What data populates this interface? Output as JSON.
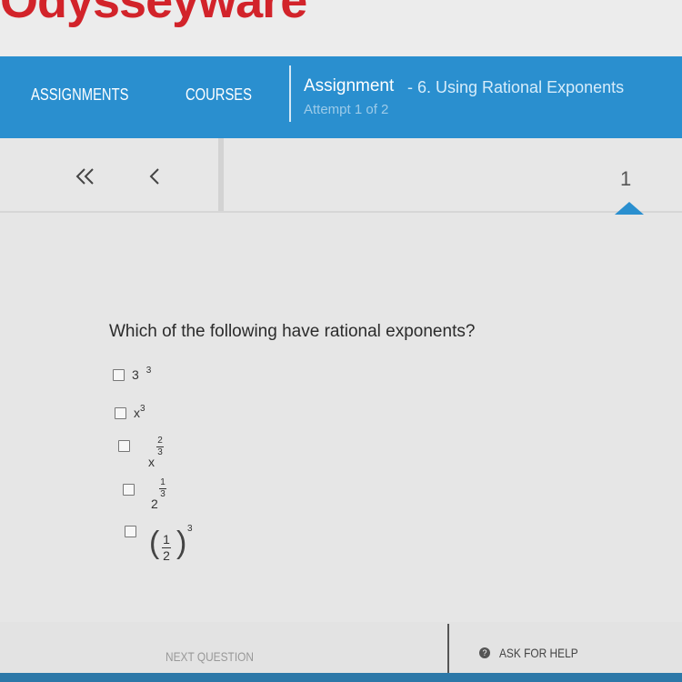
{
  "brand": {
    "logo_text": "Odysseyware",
    "color": "#d2232a"
  },
  "nav": {
    "tabs": [
      {
        "label": "ASSIGNMENTS"
      },
      {
        "label": "COURSES"
      }
    ],
    "assignment_label": "Assignment",
    "assignment_title": "- 6. Using Rational Exponents",
    "attempt": "Attempt 1 of 2",
    "color": "#2a8fcf"
  },
  "pager": {
    "first_icon": "double-chevron-left-icon",
    "prev_icon": "chevron-left-icon",
    "current_page": "1"
  },
  "question": {
    "text": "Which of the following have rational exponents?",
    "choices": [
      {
        "base": "3",
        "exponent": "3"
      },
      {
        "base": "x",
        "exponent": "3"
      },
      {
        "base": "x",
        "exponent_num": "2",
        "exponent_den": "3"
      },
      {
        "base": "2",
        "exponent_num": "1",
        "exponent_den": "3"
      },
      {
        "base_num": "1",
        "base_den": "2",
        "exponent": "3"
      }
    ]
  },
  "footer": {
    "next_label": "NEXT QUESTION",
    "help_label": "ASK FOR HELP",
    "help_icon": "help-circle-icon"
  }
}
